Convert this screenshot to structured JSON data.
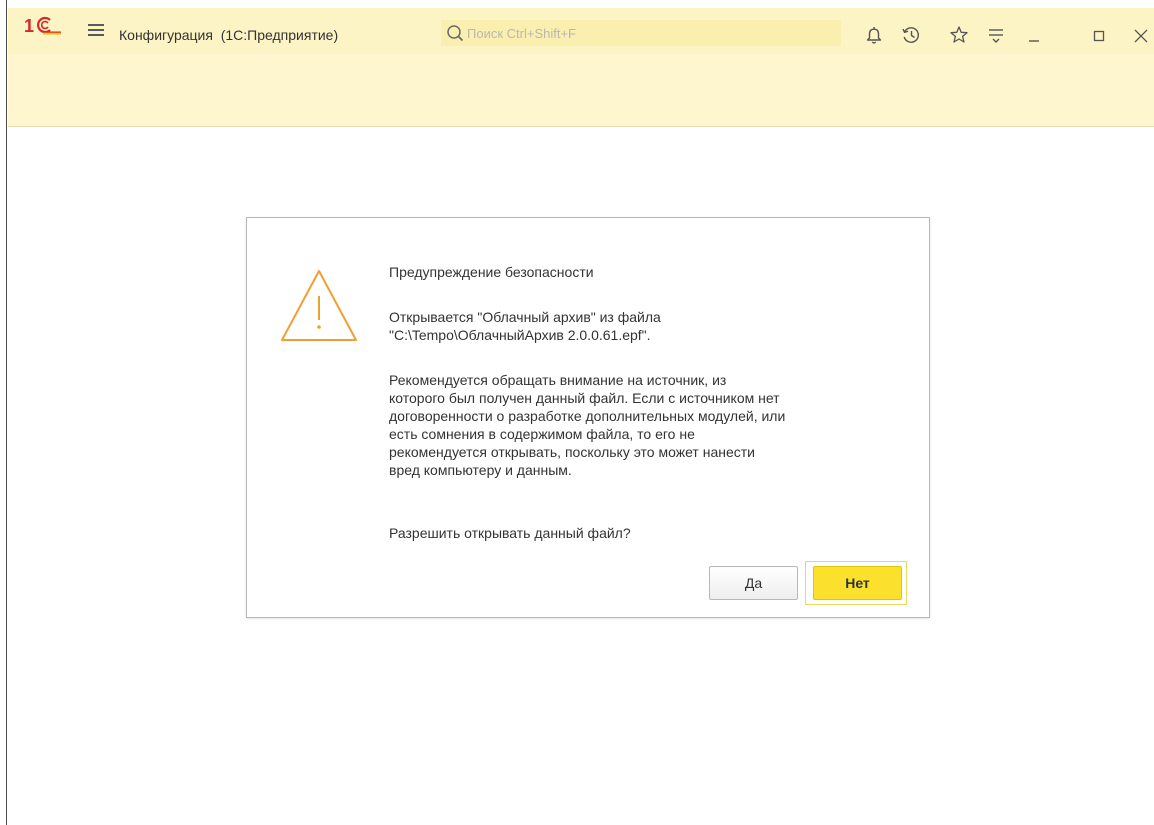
{
  "titlebar": {
    "app_title": "Конфигурация  (1С:Предприятие)",
    "logo_icon": "1c-logo-icon",
    "menu_icon": "hamburger-menu-icon",
    "search": {
      "placeholder": "Поиск Ctrl+Shift+F",
      "value": "",
      "icon": "search-icon"
    },
    "actions": [
      {
        "name": "notifications-bell-icon"
      },
      {
        "name": "history-clock-icon"
      },
      {
        "name": "favorites-star-icon"
      },
      {
        "name": "settings-menu-icon"
      },
      {
        "name": "minimize-icon"
      },
      {
        "name": "maximize-icon"
      },
      {
        "name": "close-icon"
      }
    ]
  },
  "dialog": {
    "icon": "warning-triangle-icon",
    "title": "Предупреждение безопасности",
    "message_file": "Открывается \"Облачный архив\" из файла\n\"C:\\Tempo\\ОблачныйАрхив 2.0.0.61.epf\".",
    "message_recommendation": "Рекомендуется обращать внимание на источник, из\nкоторого был получен данный файл. Если с источником нет\nдоговоренности о разработке дополнительных модулей, или\nесть сомнения в содержимом файла, то его не\nрекомендуется открывать, поскольку это может нанести\nвред компьютеру и данным.",
    "question": "Разрешить открывать данный файл?",
    "yes_label": "Да",
    "no_label": "Нет"
  },
  "colors": {
    "titlebar_bg": "#fcf4c4",
    "toolbar_bg": "#fdf6cf",
    "search_bg": "#fbefb0",
    "accent_yellow": "#fbe02c",
    "warning_orange": "#f0a030",
    "logo_red": "#d9262b",
    "logo_yellow": "#f6c500"
  }
}
